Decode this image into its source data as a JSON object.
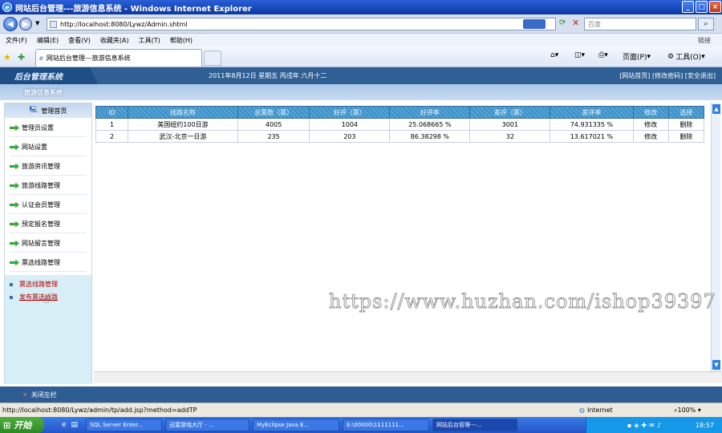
{
  "window": {
    "title": "网站后台管理---旅游信息系统 - Windows Internet Explorer",
    "min": "_",
    "max": "□",
    "close": "×"
  },
  "browser": {
    "address": "http://localhost:8080/Lywz/Admin.shtml",
    "search_placeholder": "百度",
    "menu": [
      "文件(F)",
      "编辑(E)",
      "查看(V)",
      "收藏夹(A)",
      "工具(T)",
      "帮助(H)"
    ],
    "menu_right": "链接",
    "tab_label": "网站后台管理---旅游信息系统",
    "toolbar": {
      "page": "页面(P)",
      "tools": "工具(O)"
    }
  },
  "app": {
    "title": "后台管理系统",
    "date": "2011年8月12日  星期五  丙戌年  六月十二",
    "links": "[网站首页] [修改密码] [安全退出]",
    "subtitle": "旅游信息系统",
    "home": "管理首页",
    "sidebar": [
      "管理员设置",
      "网站设置",
      "旅游资讯管理",
      "旅游线路管理",
      "认证会员管理",
      "预定报名管理",
      "网站留言管理",
      "票选线路管理"
    ],
    "sublinks": [
      "票选线路管理",
      "发布票选线路"
    ],
    "close_sidebar": "关闭左栏",
    "table": {
      "headers": [
        "ID",
        "线路名称",
        "总票数（票）",
        "好评（票）",
        "好评率",
        "差评（票）",
        "差评率",
        "修改",
        "选择"
      ],
      "rows": [
        [
          "1",
          "美国纽约100日游",
          "4005",
          "1004",
          "25.068665 %",
          "3001",
          "74.931335 %",
          "修改",
          "删除"
        ],
        [
          "2",
          "武汉-北京一日游",
          "235",
          "203",
          "86.38298 %",
          "32",
          "13.617021 %",
          "修改",
          "删除"
        ]
      ]
    },
    "watermark": "https://www.huzhan.com/ishop39397"
  },
  "status": {
    "url": "http://localhost:8080/Lywz/admin/tp/add.jsp?method=addTP",
    "zone": "Internet",
    "zoom": "100%"
  },
  "taskbar": {
    "start": "开始",
    "tasks": [
      "SQL Server Enter...",
      "迅雷游戏大厅 - ...",
      "MyEclipse Java E...",
      "E:\\00000\\1111111...",
      "网站后台管理---..."
    ],
    "clock": "18:57"
  }
}
